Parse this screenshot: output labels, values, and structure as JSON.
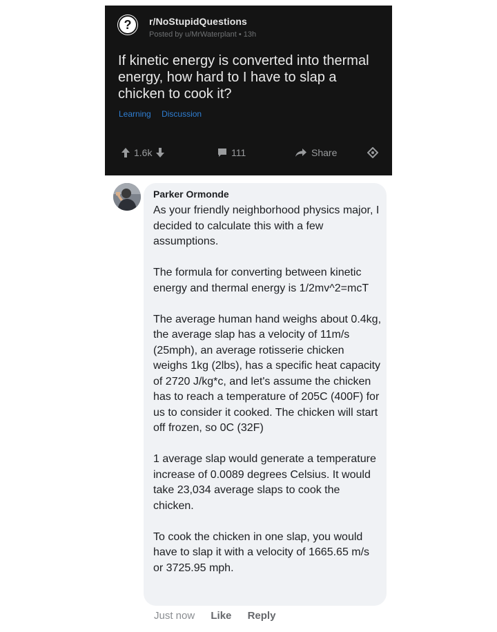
{
  "post": {
    "subreddit": "r/NoStupidQuestions",
    "posted_by": "Posted by u/MrWaterplant • 13h",
    "title": "If kinetic energy is converted into thermal energy, how hard to I have to slap a chicken to cook it?",
    "flairs": [
      "Learning",
      "Discussion"
    ],
    "votes": "1.6k",
    "comments": "111",
    "share_label": "Share",
    "sub_icon_glyph": "?"
  },
  "comment": {
    "author": "Parker Ormonde",
    "paragraphs": [
      "As your friendly neighborhood physics major, I decided to calculate this with a few assumptions.",
      "The formula for converting between kinetic energy and thermal energy is 1/2mv^2=mcT",
      "The average human hand weighs about 0.4kg, the average slap has a velocity of 11m/s (25mph), an average rotisserie chicken weighs 1kg (2lbs), has a specific heat capacity of 2720 J/kg*c, and let's assume the chicken has to reach a temperature of 205C (400F) for us to consider it cooked. The chicken will start off frozen, so 0C (32F)",
      "1 average slap would generate a temperature increase of 0.0089 degrees Celsius. It would take 23,034 average slaps to cook the chicken.",
      "To cook the chicken in one slap, you would have to slap it with a velocity of 1665.65 m/s or 3725.95 mph."
    ],
    "time": "Just now",
    "like_label": "Like",
    "reply_label": "Reply"
  },
  "colors": {
    "reddit_bg": "#141414",
    "flair_blue": "#2f7fd4",
    "bubble_bg": "#f0f2f5",
    "footer_grey": "#65676b"
  },
  "icons": {
    "upvote": "arrow-up-icon",
    "downvote": "arrow-down-icon",
    "comment": "comment-bubble-icon",
    "share": "share-arrow-icon",
    "award": "award-icon"
  }
}
